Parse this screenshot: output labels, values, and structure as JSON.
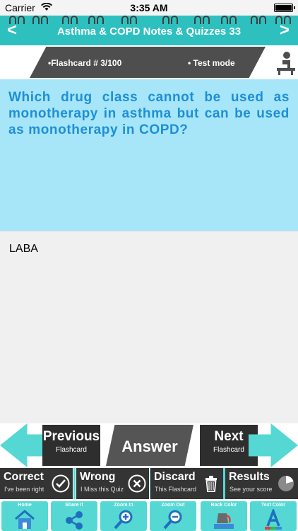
{
  "status": {
    "carrier": "Carrier",
    "time": "3:35 AM"
  },
  "header": {
    "title": "Asthma & COPD Notes & Quizzes 33",
    "prev_glyph": "<",
    "next_glyph": ">"
  },
  "info": {
    "flashcard": "•Flashcard #  3/100",
    "mode": "• Test mode"
  },
  "question": "Which drug class cannot be used as monotherapy in asthma but can be used as monotherapy in COPD?",
  "answer": "LABA",
  "nav": {
    "previous": {
      "label": "Previous",
      "sub": "Flashcard"
    },
    "answer": "Answer",
    "next": {
      "label": "Next",
      "sub": "Flashcard"
    }
  },
  "grading": {
    "correct": {
      "label": "Correct",
      "sub": "I've been right"
    },
    "wrong": {
      "label": "Wrong",
      "sub": "I Miss this Quiz"
    },
    "discard": {
      "label": "Discard",
      "sub": "This Flashcard"
    },
    "results": {
      "label": "Results",
      "sub": "See your score"
    }
  },
  "tools": [
    "Home",
    "Share It",
    "Zoom In",
    "Zoom Out",
    "Back Color",
    "Text Color"
  ],
  "colors": {
    "teal": "#2ec0bf",
    "question_bg": "#a6e6f8",
    "question_text": "#1f8fd6",
    "dark": "#343434"
  }
}
